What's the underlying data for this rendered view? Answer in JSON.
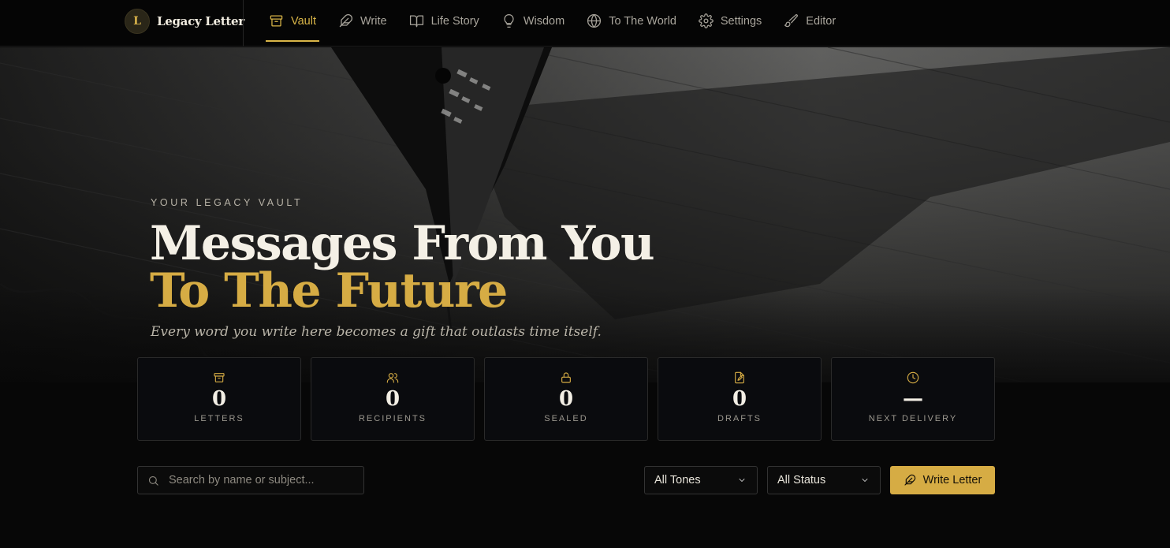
{
  "app": {
    "logo_letter": "L",
    "name": "Legacy Letter"
  },
  "nav": {
    "items": [
      {
        "label": "Vault",
        "icon": "archive-icon",
        "active": true
      },
      {
        "label": "Write",
        "icon": "feather-icon",
        "active": false
      },
      {
        "label": "Life Story",
        "icon": "book-open-icon",
        "active": false
      },
      {
        "label": "Wisdom",
        "icon": "lightbulb-icon",
        "active": false
      },
      {
        "label": "To The World",
        "icon": "globe-icon",
        "active": false
      },
      {
        "label": "Settings",
        "icon": "gear-icon",
        "active": false
      },
      {
        "label": "Editor",
        "icon": "brush-icon",
        "active": false
      }
    ]
  },
  "hero": {
    "eyebrow": "YOUR LEGACY VAULT",
    "title_line1": "Messages From You",
    "title_line2": "To The Future",
    "subtitle": "Every word you write here becomes a gift that outlasts time itself."
  },
  "stats": [
    {
      "value": "0",
      "label": "LETTERS",
      "icon": "archive-icon"
    },
    {
      "value": "0",
      "label": "RECIPIENTS",
      "icon": "users-icon"
    },
    {
      "value": "0",
      "label": "SEALED",
      "icon": "lock-icon"
    },
    {
      "value": "0",
      "label": "DRAFTS",
      "icon": "file-edit-icon"
    },
    {
      "value": "—",
      "label": "NEXT DELIVERY",
      "icon": "clock-icon"
    }
  ],
  "toolbar": {
    "search_placeholder": "Search by name or subject...",
    "tone_filter": "All Tones",
    "status_filter": "All Status",
    "write_button": "Write Letter"
  },
  "colors": {
    "accent": "#d6ac44",
    "background": "#070707",
    "card": "#0a0b0e"
  }
}
